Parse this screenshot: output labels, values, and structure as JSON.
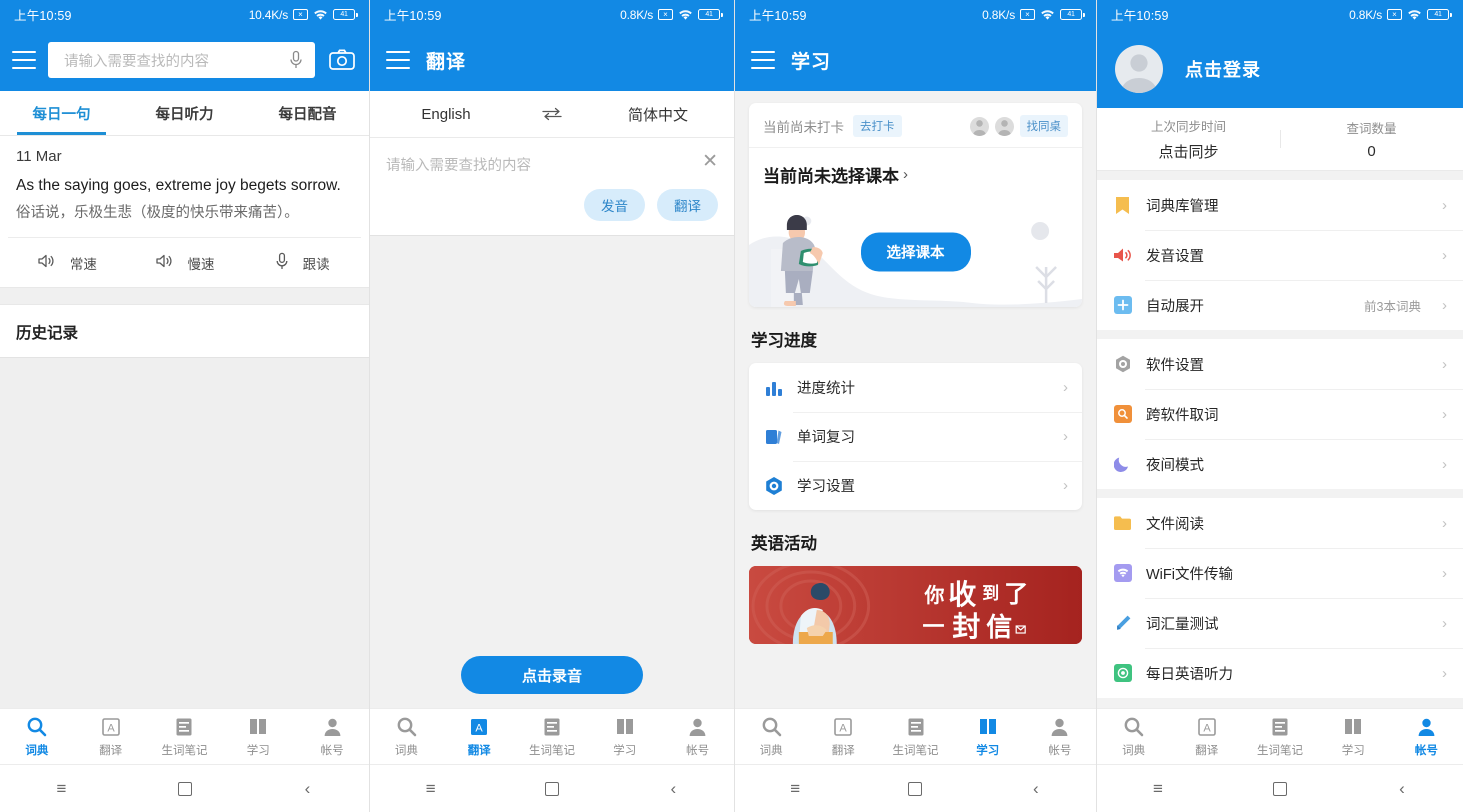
{
  "status": {
    "time": "上午10:59",
    "speed_p1": "10.4K/s",
    "speed_other": "0.8K/s",
    "battery": "41"
  },
  "nav": {
    "items": [
      {
        "label": "词典",
        "icon": "search-icon"
      },
      {
        "label": "翻译",
        "icon": "translate-icon"
      },
      {
        "label": "生词笔记",
        "icon": "notes-icon"
      },
      {
        "label": "学习",
        "icon": "book-icon"
      },
      {
        "label": "帐号",
        "icon": "account-icon"
      }
    ]
  },
  "sysnav": {
    "menu": "≡",
    "home": "□",
    "back": "‹"
  },
  "panel1": {
    "search_placeholder": "请输入需要查找的内容",
    "tabs": [
      {
        "label": "每日一句",
        "active": true
      },
      {
        "label": "每日听力",
        "active": false
      },
      {
        "label": "每日配音",
        "active": false
      }
    ],
    "daily": {
      "date": "11 Mar",
      "english": "As the saying goes, extreme joy begets sorrow.",
      "chinese": "俗话说，乐极生悲（极度的快乐带来痛苦）。"
    },
    "audio_actions": [
      {
        "label": "常速",
        "icon": "speaker-icon"
      },
      {
        "label": "慢速",
        "icon": "speaker-icon"
      },
      {
        "label": "跟读",
        "icon": "microphone-icon"
      }
    ],
    "history_title": "历史记录",
    "active_tab": "词典"
  },
  "panel2": {
    "title": "翻译",
    "source_lang": "English",
    "target_lang": "简体中文",
    "swap_icon": "swap-icon",
    "input_placeholder": "请输入需要查找的内容",
    "clear_icon": "close-icon",
    "speak_label": "发音",
    "translate_label": "翻译",
    "record_label": "点击录音",
    "active_tab": "翻译"
  },
  "panel3": {
    "title": "学习",
    "checkin_text": "当前尚未打卡",
    "checkin_btn": "去打卡",
    "deskmate_btn": "找同桌",
    "book_title": "当前尚未选择课本",
    "book_chevron": "›",
    "choose_book_btn": "选择课本",
    "progress_section_title": "学习进度",
    "progress_items": [
      {
        "label": "进度统计",
        "icon": "bar-chart-icon"
      },
      {
        "label": "单词复习",
        "icon": "cards-icon"
      },
      {
        "label": "学习设置",
        "icon": "settings-gear-icon"
      }
    ],
    "activity_section_title": "英语活动",
    "banner_text_line1": "你收到了",
    "banner_text_line2": "一封信",
    "active_tab": "学习"
  },
  "panel4": {
    "login_label": "点击登录",
    "avatar_icon": "avatar-icon",
    "stats": [
      {
        "key": "上次同步时间",
        "value": "点击同步"
      },
      {
        "key": "查词数量",
        "value": "0"
      }
    ],
    "groups": [
      {
        "items": [
          {
            "label": "词典库管理",
            "icon": "book-yellow-icon",
            "value": "",
            "color": "#f5b942"
          },
          {
            "label": "发音设置",
            "icon": "speaker-red-icon",
            "value": "",
            "color": "#e8554a"
          },
          {
            "label": "自动展开",
            "icon": "plus-blue-icon",
            "value": "前3本词典",
            "color": "#5bb6ec"
          }
        ]
      },
      {
        "items": [
          {
            "label": "软件设置",
            "icon": "gear-gray-icon",
            "value": "",
            "color": "#9a9a9a"
          },
          {
            "label": "跨软件取词",
            "icon": "orange-search-icon",
            "value": "",
            "color": "#f0903a"
          },
          {
            "label": "夜间模式",
            "icon": "moon-icon",
            "value": "",
            "color": "#8e8ce8"
          }
        ]
      },
      {
        "items": [
          {
            "label": "文件阅读",
            "icon": "folder-icon",
            "value": "",
            "color": "#f5b942"
          },
          {
            "label": "WiFi文件传输",
            "icon": "wifi-purple-icon",
            "value": "",
            "color": "#9b8ce8"
          },
          {
            "label": "词汇量测试",
            "icon": "pen-icon",
            "value": "",
            "color": "#4a9fe0"
          },
          {
            "label": "每日英语听力",
            "icon": "listen-green-icon",
            "value": "",
            "color": "#3fc380"
          }
        ]
      }
    ],
    "chevron": "›",
    "active_tab": "帐号"
  }
}
